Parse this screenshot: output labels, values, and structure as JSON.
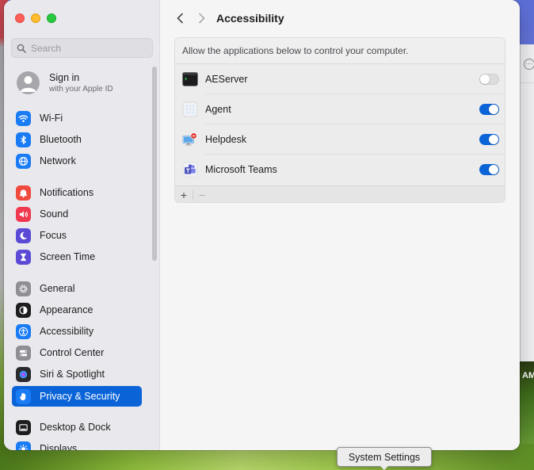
{
  "window": {
    "title": "Accessibility"
  },
  "sidebar": {
    "search_placeholder": "Search",
    "apple_id": {
      "line1": "Sign in",
      "line2": "with your Apple ID"
    },
    "items": [
      {
        "label": "Wi-Fi",
        "icon": "wifi-icon",
        "color": "#1a7cf5"
      },
      {
        "label": "Bluetooth",
        "icon": "bluetooth-icon",
        "color": "#1a7cf5"
      },
      {
        "label": "Network",
        "icon": "globe-icon",
        "color": "#1a7cf5"
      },
      {
        "label": "Notifications",
        "icon": "bell-icon",
        "color": "#f04a3f"
      },
      {
        "label": "Sound",
        "icon": "speaker-icon",
        "color": "#f0384f"
      },
      {
        "label": "Focus",
        "icon": "moon-icon",
        "color": "#5a4ad6"
      },
      {
        "label": "Screen Time",
        "icon": "hourglass-icon",
        "color": "#5a4ad6"
      },
      {
        "label": "General",
        "icon": "gear-icon",
        "color": "#8e8e93"
      },
      {
        "label": "Appearance",
        "icon": "appearance-icon",
        "color": "#1d1d1f"
      },
      {
        "label": "Accessibility",
        "icon": "accessibility-icon",
        "color": "#1a7cf5"
      },
      {
        "label": "Control Center",
        "icon": "toggles-icon",
        "color": "#8e8e93"
      },
      {
        "label": "Siri & Spotlight",
        "icon": "siri-icon",
        "color": "#2a2a2e"
      },
      {
        "label": "Privacy & Security",
        "icon": "hand-icon",
        "color": "#1a7cf5"
      },
      {
        "label": "Desktop & Dock",
        "icon": "dock-icon",
        "color": "#1d1d1f"
      },
      {
        "label": "Displays",
        "icon": "sun-icon",
        "color": "#1a7cf5"
      }
    ],
    "selected_index": 12
  },
  "content": {
    "title": "Accessibility",
    "description": "Allow the applications below to control your computer.",
    "apps": [
      {
        "name": "AEServer",
        "icon": "terminal-icon",
        "enabled": false
      },
      {
        "name": "Agent",
        "icon": "agent-icon",
        "enabled": true
      },
      {
        "name": "Helpdesk",
        "icon": "helpdesk-icon",
        "enabled": true
      },
      {
        "name": "Microsoft Teams",
        "icon": "teams-icon",
        "enabled": true
      }
    ],
    "footer": {
      "add_label": "+",
      "remove_label": "−"
    }
  },
  "tooltip": {
    "text": "System Settings"
  },
  "background": {
    "clock_fragment": "AM"
  },
  "colors": {
    "accent": "#0a64d8"
  }
}
